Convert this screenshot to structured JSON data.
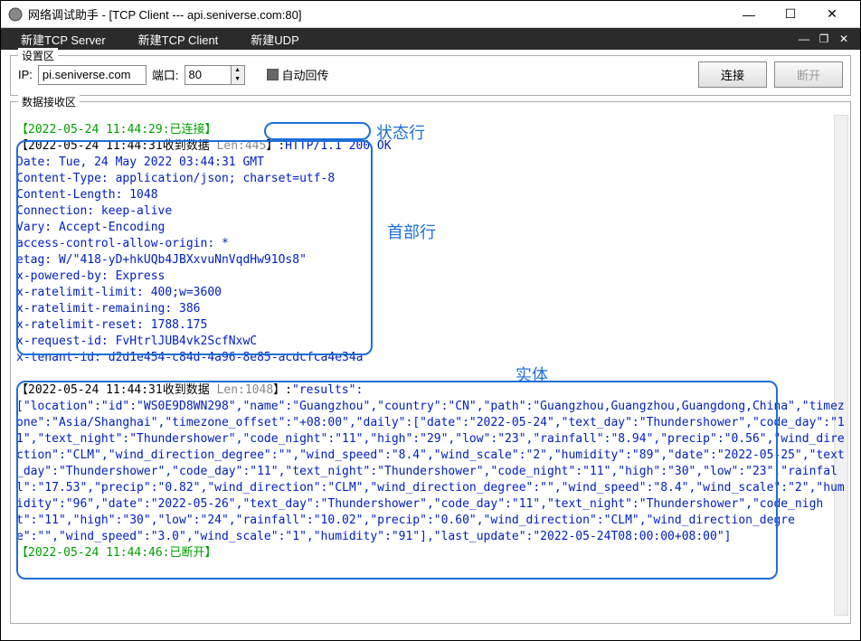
{
  "titlebar": {
    "title": "网络调试助手 - [TCP Client --- api.seniverse.com:80]"
  },
  "menu": {
    "newTcpServer": "新建TCP Server",
    "newTcpClient": "新建TCP Client",
    "newUdp": "新建UDP"
  },
  "config": {
    "legend": "设置区",
    "ipLabel": "IP:",
    "ipValue": "pi.seniverse.com",
    "portLabel": "端口:",
    "portValue": "80",
    "autoEcho": "自动回传",
    "connectBtn": "连接",
    "disconnectBtn": "断开"
  },
  "receive": {
    "legend": "数据接收区"
  },
  "log": {
    "line1": "【2022-05-24 11:44:29:已连接】",
    "line2a": "【2022-05-24 11:44:31收到数据 ",
    "line2b": "Len:445",
    "line2c": "】:",
    "statusLine": "HTTP/1.1 200 OK",
    "headers": "Date: Tue, 24 May 2022 03:44:31 GMT\nContent-Type: application/json; charset=utf-8\nContent-Length: 1048\nConnection: keep-alive\nVary: Accept-Encoding\naccess-control-allow-origin: *\netag: W/\"418-yD+hkUQb4JBXxvuNnVqdHw91Os8\"\nx-powered-by: Express\nx-ratelimit-limit: 400;w=3600\nx-ratelimit-remaining: 386\nx-ratelimit-reset: 1788.175\nx-request-id: FvHtrlJUB4vk2ScfNxwC\nx-tenant-id: d2d1e454-c84d-4a96-8e85-acdcfca4e34a",
    "line4a": "【2022-05-24 11:44:31收到数据 ",
    "line4b": "Len:1048",
    "line4c": "】:",
    "body": "\"results\":\n[\"location\":\"id\":\"WS0E9D8WN298\",\"name\":\"Guangzhou\",\"country\":\"CN\",\"path\":\"Guangzhou,Guangzhou,Guangdong,China\",\"timezone\":\"Asia/Shanghai\",\"timezone_offset\":\"+08:00\",\"daily\":[\"date\":\"2022-05-24\",\"text_day\":\"Thundershower\",\"code_day\":\"11\",\"text_night\":\"Thundershower\",\"code_night\":\"11\",\"high\":\"29\",\"low\":\"23\",\"rainfall\":\"8.94\",\"precip\":\"0.56\",\"wind_direction\":\"CLM\",\"wind_direction_degree\":\"\",\"wind_speed\":\"8.4\",\"wind_scale\":\"2\",\"humidity\":\"89\",\"date\":\"2022-05-25\",\"text_day\":\"Thundershower\",\"code_day\":\"11\",\"text_night\":\"Thundershower\",\"code_night\":\"11\",\"high\":\"30\",\"low\":\"23\",\"rainfall\":\"17.53\",\"precip\":\"0.82\",\"wind_direction\":\"CLM\",\"wind_direction_degree\":\"\",\"wind_speed\":\"8.4\",\"wind_scale\":\"2\",\"humidity\":\"96\",\"date\":\"2022-05-26\",\"text_day\":\"Thundershower\",\"code_day\":\"11\",\"text_night\":\"Thundershower\",\"code_night\":\"11\",\"high\":\"30\",\"low\":\"24\",\"rainfall\":\"10.02\",\"precip\":\"0.60\",\"wind_direction\":\"CLM\",\"wind_direction_degree\":\"\",\"wind_speed\":\"3.0\",\"wind_scale\":\"1\",\"humidity\":\"91\"],\"last_update\":\"2022-05-24T08:00:00+08:00\"]",
    "line5": "【2022-05-24 11:44:46:已断开】"
  },
  "annotations": {
    "statusLine": "状态行",
    "headerLines": "首部行",
    "entity": "实体"
  }
}
